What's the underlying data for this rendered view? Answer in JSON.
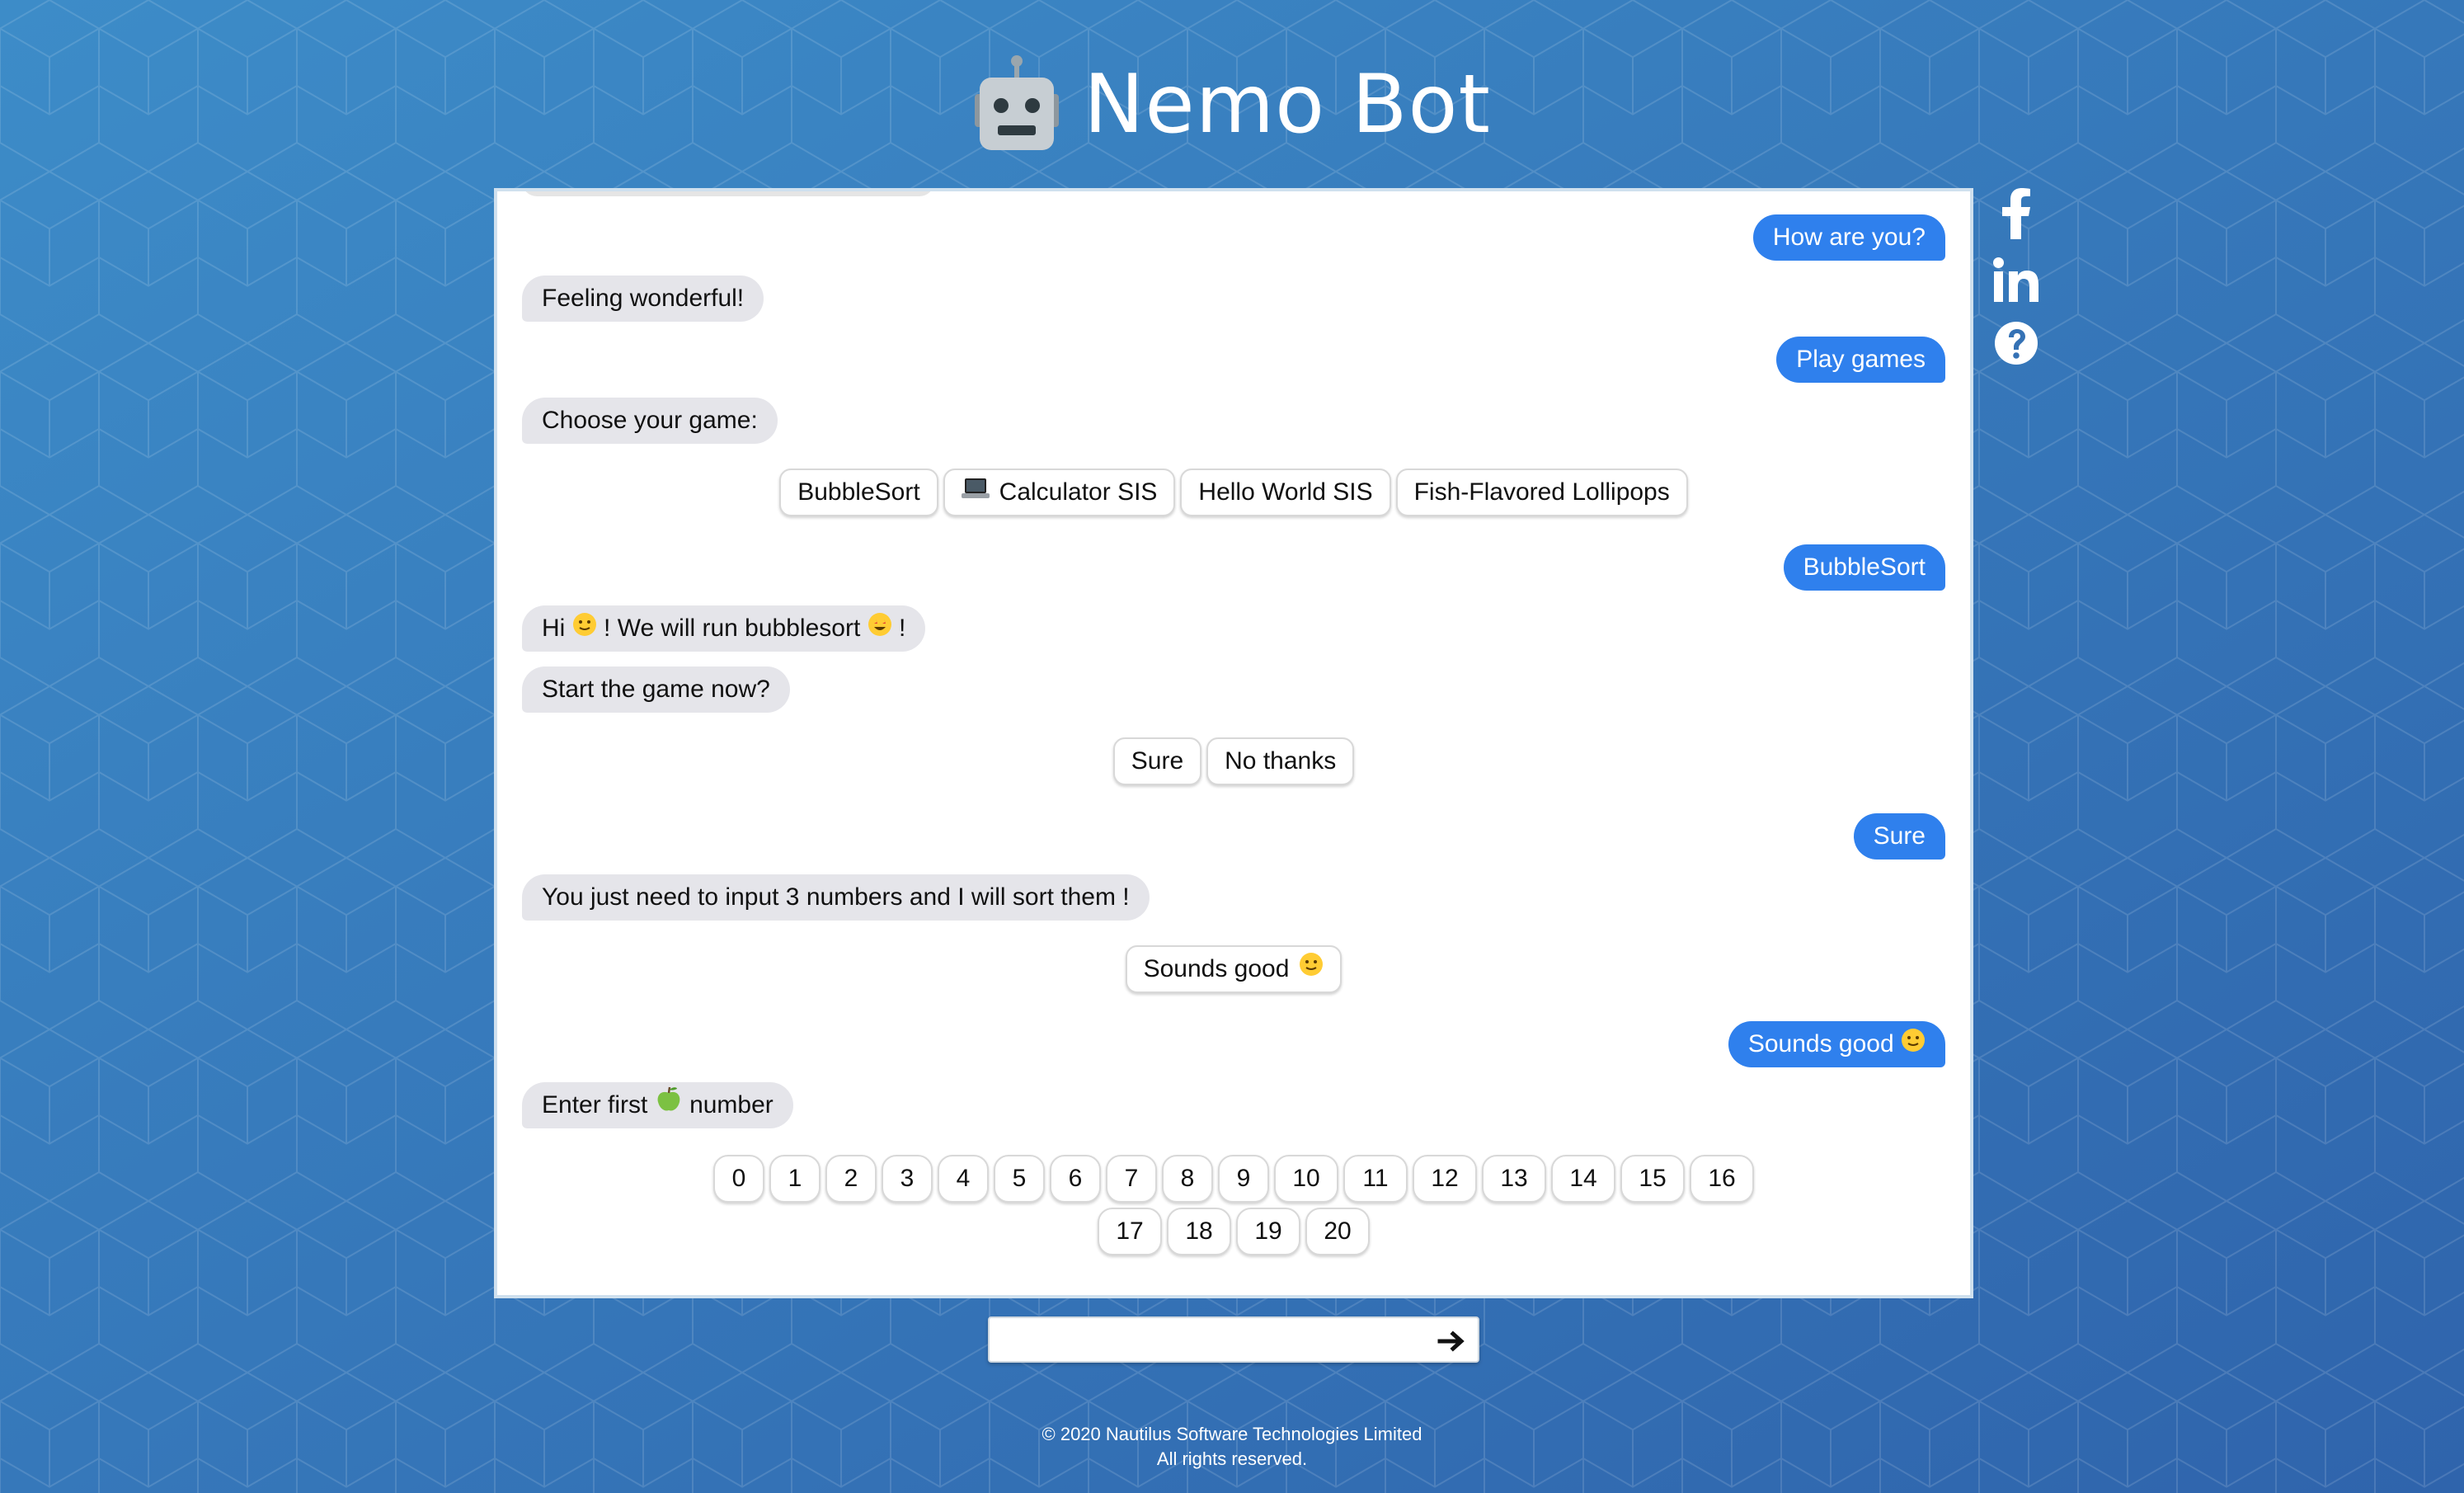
{
  "header": {
    "title": "Nemo Bot",
    "logo_icon": "robot-icon"
  },
  "colors": {
    "background": "#3a82c2",
    "user_bubble": "#2f80ed",
    "bot_bubble": "#e5e5ea"
  },
  "messages": {
    "m1": "How are you?",
    "m2": "Feeling wonderful!",
    "m3": "Play games",
    "m4": "Choose your game:",
    "m5": "BubbleSort",
    "m6a": "Hi",
    "m6b": "! We will run bubblesort",
    "m6c": "!",
    "m7": "Start the game now?",
    "m8": "Sure",
    "m9": "You just need to input 3 numbers and I will sort them !",
    "m10": "Sounds good",
    "m11a": "Enter first",
    "m11b": "number"
  },
  "options": {
    "games": [
      "BubbleSort",
      "Calculator SIS",
      "Hello World SIS",
      "Fish-Flavored Lollipops"
    ],
    "start": [
      "Sure",
      "No thanks"
    ],
    "confirm": "Sounds good",
    "numbers": [
      "0",
      "1",
      "2",
      "3",
      "4",
      "5",
      "6",
      "7",
      "8",
      "9",
      "10",
      "11",
      "12",
      "13",
      "14",
      "15",
      "16",
      "17",
      "18",
      "19",
      "20"
    ]
  },
  "social": {
    "icons": [
      "facebook-icon",
      "linkedin-icon",
      "help-icon"
    ]
  },
  "input": {
    "value": "",
    "send_icon": "arrow-right-icon"
  },
  "footer": {
    "line1": "© 2020 Nautilus Software Technologies Limited",
    "line2": "All rights reserved."
  }
}
